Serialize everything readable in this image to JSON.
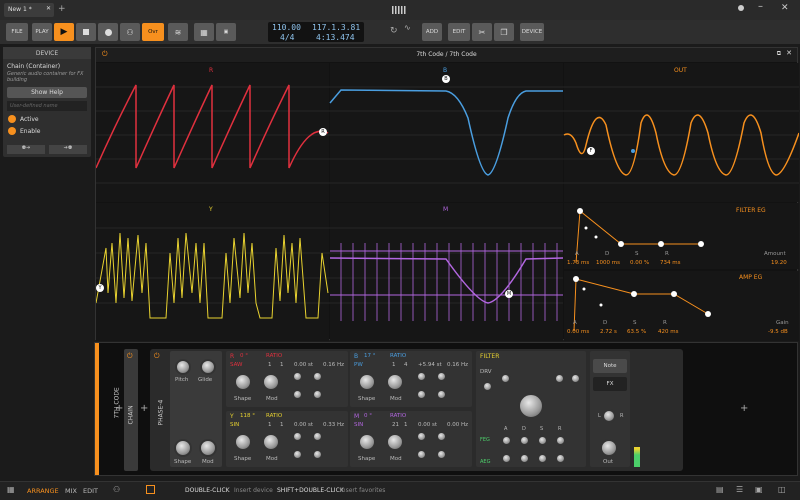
{
  "titlebar": {
    "tab": "New 1 *"
  },
  "toolbar": {
    "file": "FILE",
    "play": "PLAY",
    "ovr": "Ovr",
    "tempo": "110.00",
    "sig": "4/4",
    "pos": "117.1.3.81",
    "time": "4:13.474",
    "add": "ADD",
    "edit": "EDIT",
    "device": "DEVICE"
  },
  "inspector": {
    "title": "DEVICE",
    "name": "Chain (Container)",
    "desc": "Generic audio container for FX building",
    "help": "Show Help",
    "userdef": "User-defined name",
    "active": "Active",
    "enable": "Enable"
  },
  "scope": {
    "title": "7th Code / 7th Code",
    "panels": {
      "r": "R",
      "b": "B",
      "out": "OUT",
      "y": "Y",
      "m": "M"
    },
    "filter_eg": {
      "title": "FILTER EG",
      "labels": [
        "A",
        "D",
        "S",
        "R"
      ],
      "values": [
        "1.73 ms",
        "1000 ms",
        "0.00 %",
        "734 ms"
      ],
      "param": "Amount",
      "param_val": "19.20"
    },
    "amp_eg": {
      "title": "AMP EG",
      "labels": [
        "A",
        "D",
        "S",
        "R"
      ],
      "values": [
        "0.00 ms",
        "2.72 s",
        "63.5 %",
        "420 ms"
      ],
      "param": "Gain",
      "param_val": "-9.5 dB"
    },
    "point_labels": {
      "b": "B",
      "r": "R",
      "f": "F",
      "y": "Y",
      "m": "M"
    }
  },
  "devices": {
    "track": "7TH CODE",
    "chain": "CHAIN",
    "phase": "PHASE-4",
    "phase4": {
      "pitch": "Pitch",
      "glide": "Glide",
      "shape": "Shape",
      "mod": "Mod"
    },
    "osc": [
      {
        "name": "R",
        "deg": "0 °",
        "wave": "SAW",
        "ratio": "RATIO",
        "r1": "1",
        "r2": "1",
        "st": "0.00 st",
        "hz": "0.16 Hz",
        "shape": "Shape",
        "mod": "Mod",
        "color": "#e0303e"
      },
      {
        "name": "B",
        "deg": "17 °",
        "wave": "PW",
        "ratio": "RATIO",
        "r1": "1",
        "r2": "4",
        "st": "+5.94 st",
        "hz": "0.16 Hz",
        "shape": "Shape",
        "mod": "Mod",
        "color": "#4a9ee0"
      },
      {
        "name": "Y",
        "deg": "118 °",
        "wave": "SIN",
        "ratio": "RATIO",
        "r1": "1",
        "r2": "1",
        "st": "0.00 st",
        "hz": "0.33 Hz",
        "shape": "Shape",
        "mod": "Mod",
        "color": "#e8d230"
      },
      {
        "name": "M",
        "deg": "0 °",
        "wave": "SIN",
        "ratio": "RATIO",
        "r1": "21",
        "r2": "1",
        "st": "0.00 st",
        "hz": "0.00 Hz",
        "shape": "Shape",
        "mod": "Mod",
        "color": "#b266e0"
      }
    ],
    "filter": {
      "title": "FILTER",
      "drv": "DRV",
      "feg": "FEG",
      "aeg": "AEG",
      "adsr": [
        "A",
        "D",
        "S",
        "R"
      ],
      "note": "Note",
      "fx": "FX",
      "out": "Out",
      "l": "L",
      "r": "R"
    }
  },
  "bottombar": {
    "arrange": "ARRANGE",
    "mix": "MIX",
    "edit": "EDIT",
    "dbl": "DOUBLE-CLICK",
    "dbl_hint": "Insert device",
    "shift": "SHIFT+DOUBLE-CLICK",
    "shift_hint": "Insert favorites"
  },
  "colors": {
    "accent": "#f7901e",
    "red": "#e0303e",
    "blue": "#4a9ee0",
    "yellow": "#e8d230",
    "purple": "#b266e0"
  }
}
